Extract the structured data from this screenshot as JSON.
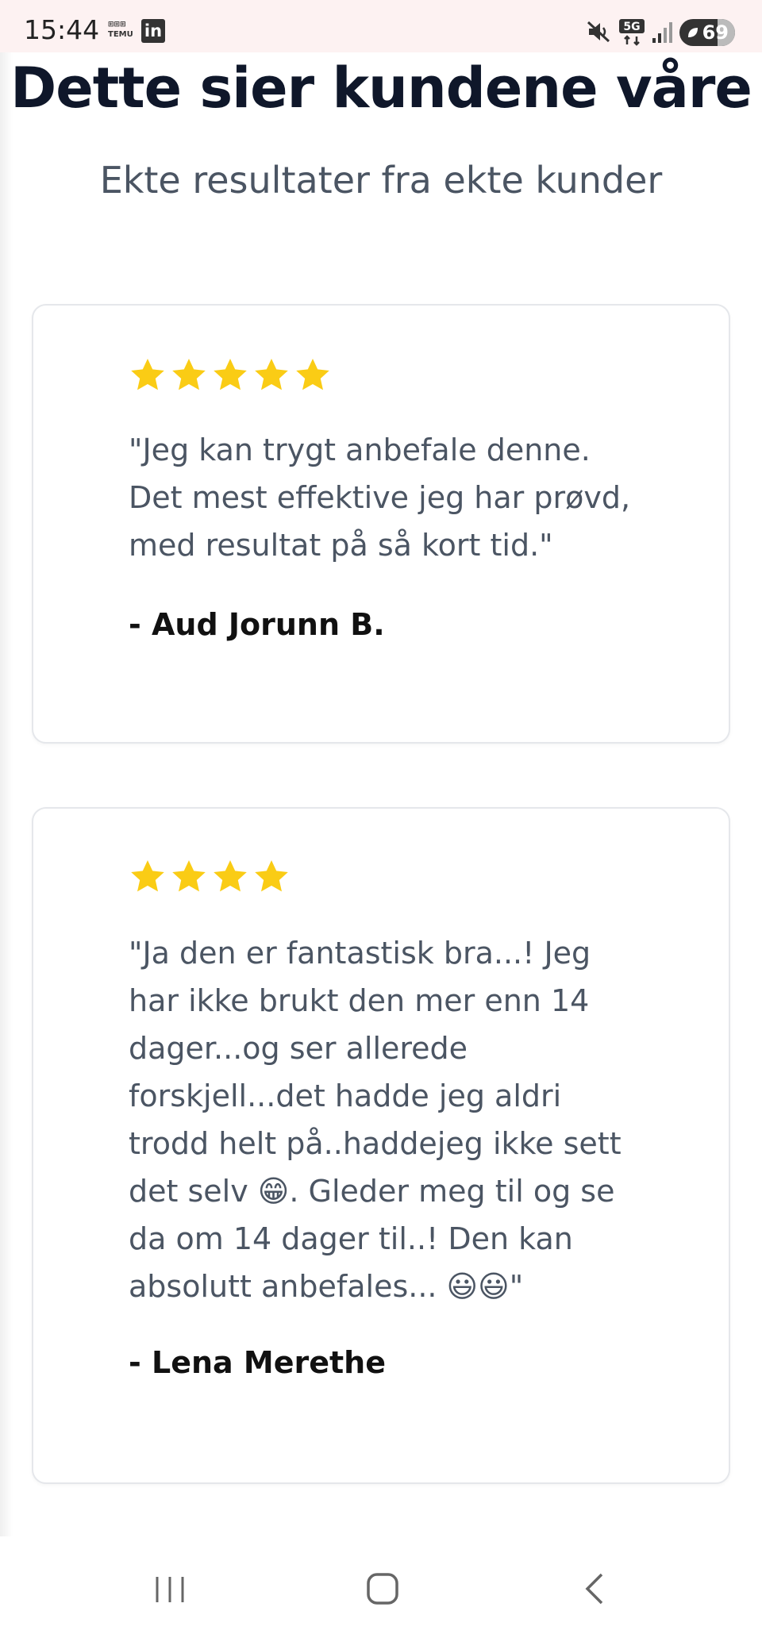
{
  "status_bar": {
    "time": "15:44",
    "temu_label": "TEMU",
    "linkedin_label": "in",
    "battery": "69",
    "network": "5G"
  },
  "header": {
    "title": "Dette sier kundene våre",
    "subtitle": "Ekte resultater fra ekte kunder"
  },
  "testimonials": [
    {
      "rating": 5,
      "quote": "\"Jeg kan trygt anbefale denne.\nDet mest effektive jeg har prøvd,\nmed resultat på så kort tid.\"",
      "author": "- Aud Jorunn B."
    },
    {
      "rating": 4,
      "quote": "\"Ja den er fantastisk bra...! Jeg\nhar ikke brukt den mer enn 14\ndager...og ser allerede\nforskjell...det hadde jeg aldri\ntrodd helt på..haddejeg ikke sett\ndet selv 😁. Gleder meg til og se\nda om 14 dager til..! Den kan\nabsolutt anbefales... 😃😃\"",
      "author": "- Lena Merethe"
    }
  ],
  "colors": {
    "star": "#facc15",
    "title": "#0f172a",
    "body_text": "#4b5563",
    "card_border": "#e5e7eb"
  },
  "icons": {
    "nav": [
      "recent-apps-icon",
      "home-icon",
      "back-icon"
    ],
    "status": [
      "mute-icon",
      "5g-icon",
      "signal-icon",
      "battery-icon"
    ]
  }
}
